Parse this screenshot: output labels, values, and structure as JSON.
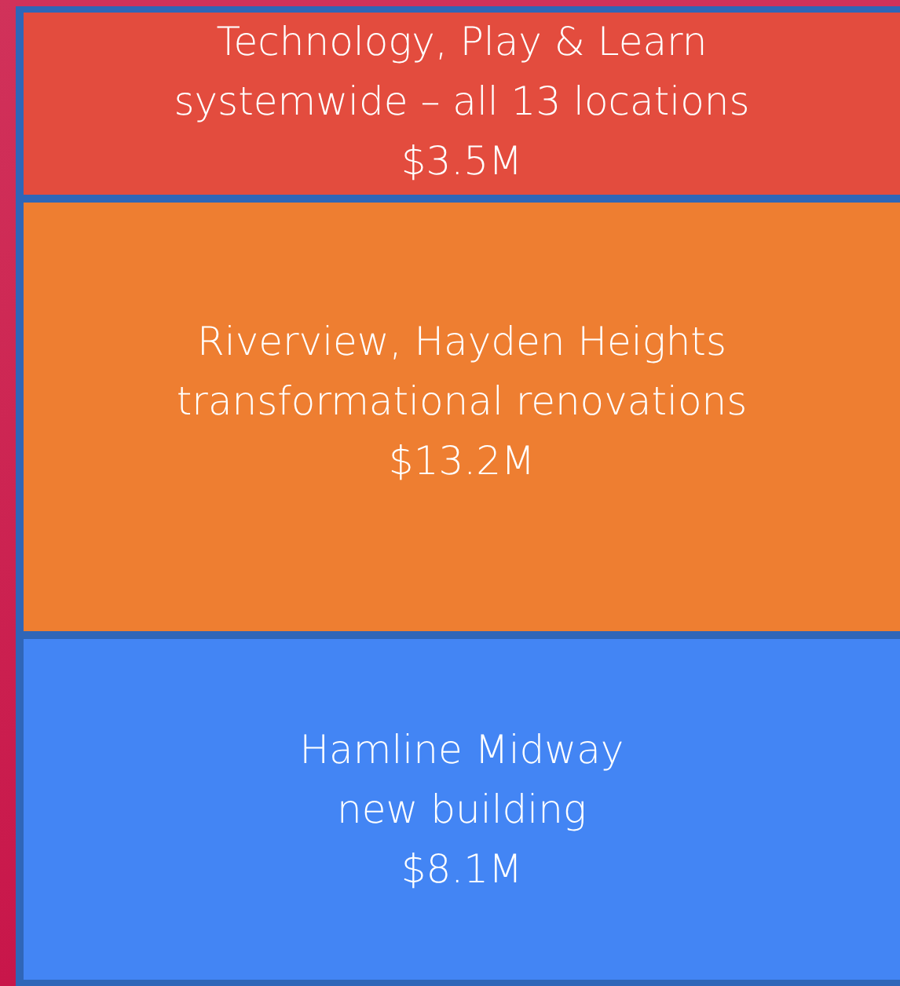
{
  "blocks": [
    {
      "lines": [
        "Technology, Play & Learn",
        "systemwide – all 13 locations",
        "$3.5M"
      ],
      "color": "#e34c3e"
    },
    {
      "lines": [
        "Riverview, Hayden Heights",
        "transformational renovations",
        "$13.2M"
      ],
      "color": "#ee7e31"
    },
    {
      "lines": [
        "Hamline Midway",
        "new building",
        "$8.1M"
      ],
      "color": "#4385f4"
    }
  ]
}
